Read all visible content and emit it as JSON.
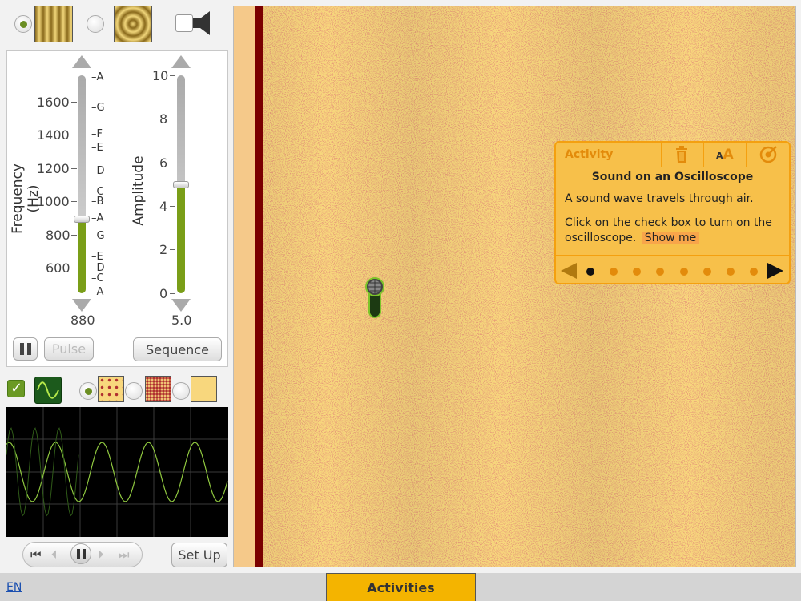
{
  "wave_type": {
    "selected": "plane",
    "options": [
      {
        "name": "plane-wave",
        "icon": "plane-wave-icon"
      },
      {
        "name": "circular-wave",
        "icon": "circular-wave-icon"
      }
    ]
  },
  "sound": {
    "enabled": false,
    "icon": "speaker-icon"
  },
  "frequency": {
    "label": "Frequency (Hz)",
    "ticks": [
      "1600",
      "1400",
      "1200",
      "1000",
      "800",
      "600"
    ],
    "notes": [
      "A",
      "G",
      "F",
      "E",
      "D",
      "C",
      "B",
      "A",
      "G",
      "E",
      "D",
      "C",
      "A"
    ],
    "value": "880",
    "range": [
      440,
      1760
    ],
    "current": 880
  },
  "amplitude": {
    "label": "Amplitude",
    "ticks": [
      "10",
      "8",
      "6",
      "4",
      "2",
      "0"
    ],
    "value": "5.0",
    "range": [
      0,
      10
    ],
    "current": 5.0
  },
  "buttons": {
    "pulse": "Pulse",
    "sequence": "Sequence",
    "setup": "Set Up"
  },
  "oscilloscope": {
    "enabled": true,
    "icon": "waveform-icon"
  },
  "particle_view": {
    "selected": "few-particles",
    "options": [
      "few-particles",
      "many-particles",
      "no-particles"
    ]
  },
  "activity": {
    "title": "Activity",
    "heading": "Sound on an Oscilloscope",
    "line1": "A sound wave travels through air.",
    "line2": "Click on the check box to turn on the oscilloscope.",
    "show_me": "Show me",
    "pages": 8,
    "current_page": 1
  },
  "bottom": {
    "language": "EN",
    "tab": "Activities"
  },
  "colors": {
    "accent_green": "#7a9e18",
    "activity_bg": "#f7c04a",
    "field_bg": "#f8d77d",
    "wall": "#7a0000"
  }
}
